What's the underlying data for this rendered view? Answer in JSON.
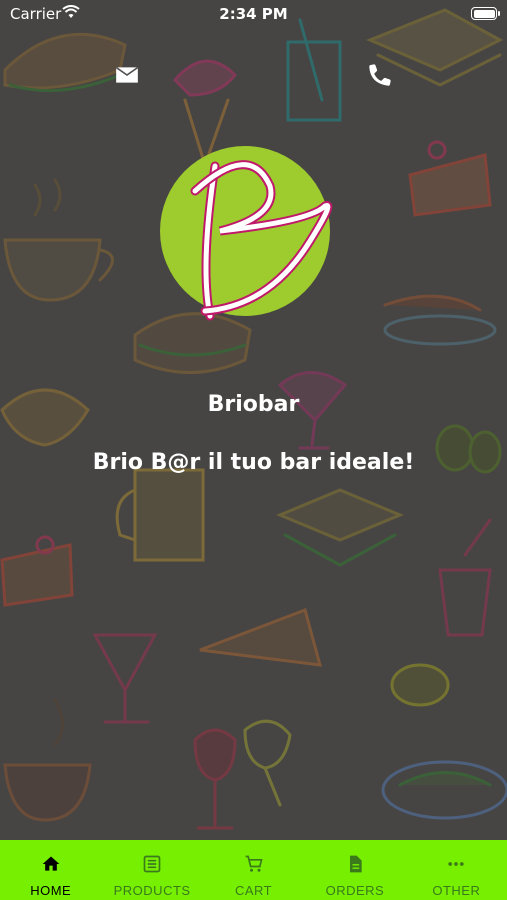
{
  "status_bar": {
    "carrier": "Carrier",
    "time": "2:34 PM"
  },
  "header": {
    "mail_icon": "mail-icon",
    "phone_icon": "phone-icon"
  },
  "brand": {
    "logo_letter": "B",
    "logo_color": "#9ecb2d",
    "name": "Briobar",
    "tagline": "Brio B@r il tuo bar ideale!"
  },
  "tab_bar": {
    "background": "#76f000",
    "active_color": "#000000",
    "inactive_color": "#3a7a1a",
    "tabs": [
      {
        "label": "HOME",
        "icon": "home-icon",
        "active": true
      },
      {
        "label": "PRODUCTS",
        "icon": "list-icon",
        "active": false
      },
      {
        "label": "CART",
        "icon": "cart-icon",
        "active": false
      },
      {
        "label": "ORDERS",
        "icon": "document-icon",
        "active": false
      },
      {
        "label": "OTHER",
        "icon": "more-icon",
        "active": false
      }
    ]
  }
}
